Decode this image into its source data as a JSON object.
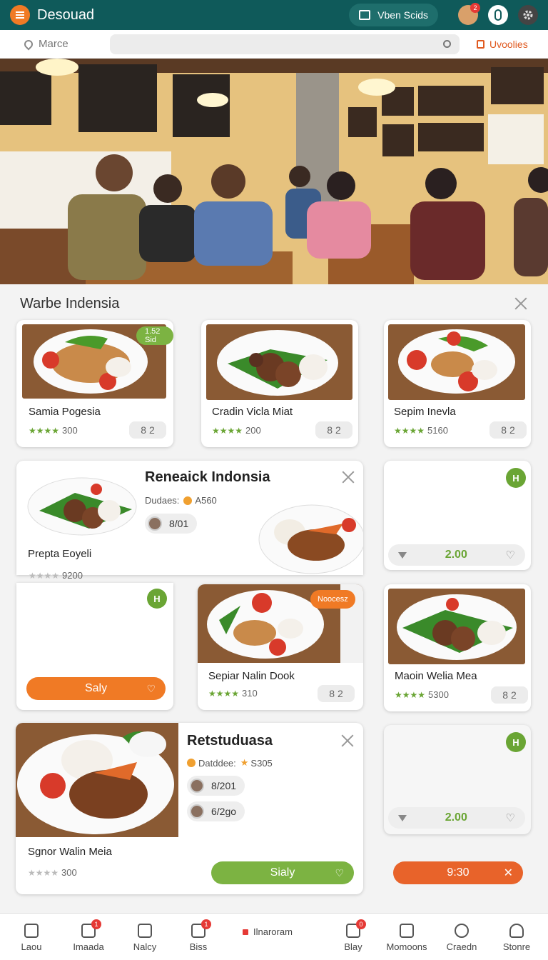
{
  "header": {
    "title": "Desouad",
    "action_label": "Vben Scids",
    "icons": [
      "menu-icon",
      "video-icon",
      "user-avatar-icon",
      "info-icon",
      "settings-icon"
    ],
    "avatar_badge": "2"
  },
  "search": {
    "location_label": "Marce",
    "placeholder": "",
    "favorites_label": "Uvoolies"
  },
  "section": {
    "title": "Warbe Indensia"
  },
  "row1": [
    {
      "title": "Samia Pogesia",
      "rating": "300",
      "qty": "8 2",
      "tag": "1.52 Sid"
    },
    {
      "title": "Cradin Vicla Miat",
      "rating": "200",
      "qty": "8 2"
    },
    {
      "title": "Sepim Inevla",
      "rating": "5160",
      "qty": "8 2"
    }
  ],
  "featured1": {
    "title": "Reneaick Indonsia",
    "meta": "Dudaes:",
    "meta_value": "A560",
    "chip": "8/01",
    "item_title": "Prepta Eoyeli",
    "rating": "9200"
  },
  "side1": {
    "badge": "H",
    "price": "2.00"
  },
  "left_empty": {
    "badge": "H",
    "button_label": "Saly"
  },
  "row2": [
    {
      "title": "Sepiar Nalin Dook",
      "rating": "310",
      "qty": "8 2",
      "tag": "Noocesz"
    },
    {
      "title": "Maoin Welia Mea",
      "rating": "5300",
      "qty": "8 2"
    }
  ],
  "featured2": {
    "title": "Retstuduasa",
    "meta": "Datddee:",
    "meta_value": "S305",
    "chips": [
      "8/201",
      "6/2go"
    ],
    "item_title": "Sgnor Walin Meia",
    "rating": "300",
    "button_label": "Sialy"
  },
  "side2": {
    "badge": "H",
    "price": "2.00"
  },
  "timer_button": {
    "label": "9:30"
  },
  "bottom_nav": {
    "items": [
      {
        "label": "Laou"
      },
      {
        "label": "Imaada",
        "badge": "1"
      },
      {
        "label": "Nalcy"
      },
      {
        "label": "Biss",
        "badge": "1"
      },
      {
        "label": "Ilnaroram"
      },
      {
        "label": "Blay",
        "badge": "0"
      },
      {
        "label": "Momoons"
      },
      {
        "label": "Craedn"
      },
      {
        "label": "Stonre"
      }
    ]
  },
  "colors": {
    "header_bg": "#0f5a5a",
    "accent_orange": "#f07a25",
    "accent_green": "#7cb342"
  }
}
